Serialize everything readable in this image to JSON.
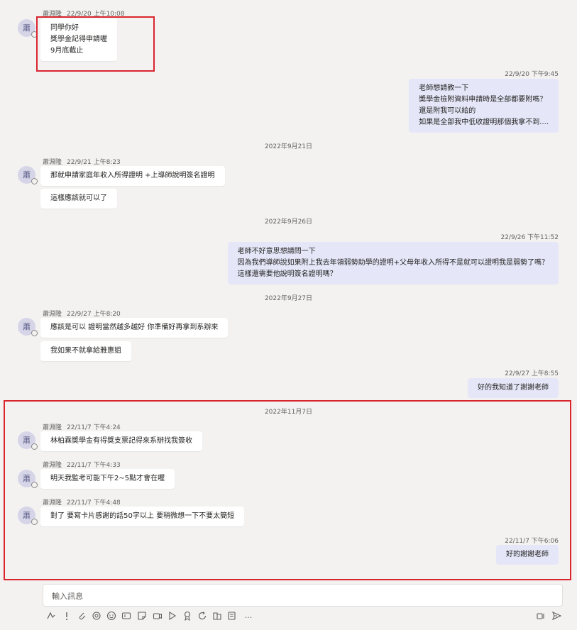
{
  "messages": {
    "m1": {
      "sender": "蕭淵隆",
      "time": "22/9/20 上午10:08",
      "avatar": "蕭",
      "lines": [
        "同學你好",
        "獎學金記得申請喔",
        "9月底截止"
      ]
    },
    "m2": {
      "time": "22/9/20 下午9:45",
      "lines": [
        "老師想請教一下",
        "獎學金檢附資料申請時是全部都要附嗎？",
        "還是附我可以給的",
        "如果是全部我中低收證明那個我拿不到...."
      ]
    },
    "d1": "2022年9月21日",
    "m3": {
      "sender": "蕭淵隆",
      "time": "22/9/21 上午8:23",
      "avatar": "蕭",
      "text1": "那就申請家庭年收入所得證明 +上導師說明簽名證明",
      "text2": "這樣應該就可以了"
    },
    "d2": "2022年9月26日",
    "m4": {
      "time": "22/9/26 下午11:52",
      "lines": [
        "老師不好意思想請問一下",
        "因為我們導師說如果附上我去年領弱勢助學的證明+父母年收入所得不是就可以證明我是弱勢了嗎？",
        "這樣還需要他說明簽名證明嗎？"
      ]
    },
    "d3": "2022年9月27日",
    "m5": {
      "sender": "蕭淵隆",
      "time": "22/9/27 上午8:20",
      "avatar": "蕭",
      "text1": "應該是可以 證明當然越多越好 你準備好再拿到系辦來",
      "text2": "我如果不就拿給雅惠姐"
    },
    "m6": {
      "time": "22/9/27 上午8:55",
      "text": "好的我知道了謝謝老師"
    },
    "d4": "2022年11月7日",
    "m7": {
      "sender": "蕭淵隆",
      "time": "22/11/7 下午4:24",
      "avatar": "蕭",
      "text": "林柏霖獎學金有得獎支票記得來系辦找我簽收"
    },
    "m8": {
      "sender": "蕭淵隆",
      "time": "22/11/7 下午4:33",
      "avatar": "蕭",
      "text": "明天我監考可能下午2~5點才會在喔"
    },
    "m9": {
      "sender": "蕭淵隆",
      "time": "22/11/7 下午4:48",
      "avatar": "蕭",
      "text": "對了 要寫卡片感謝的話50字以上 要稍微想一下不要太簡短"
    },
    "m10": {
      "time": "22/11/7 下午6:06",
      "text": "好的謝謝老師"
    }
  },
  "composer": {
    "placeholder": "輸入訊息"
  },
  "toolbar": {
    "icons": [
      "format-icon",
      "priority-icon",
      "attach-icon",
      "loop-icon",
      "emoji-icon",
      "gif-icon",
      "sticker-icon",
      "meet-icon",
      "stream-icon",
      "praise-icon",
      "update-icon",
      "apps-icon",
      "more-app-icon",
      "more-icon",
      "dictate-icon",
      "send-icon"
    ],
    "more": "..."
  },
  "colors": {
    "incoming": "#ffffff",
    "outgoing": "#e5e7f8",
    "highlight": "#d9252e",
    "background": "#f3f2f1"
  }
}
